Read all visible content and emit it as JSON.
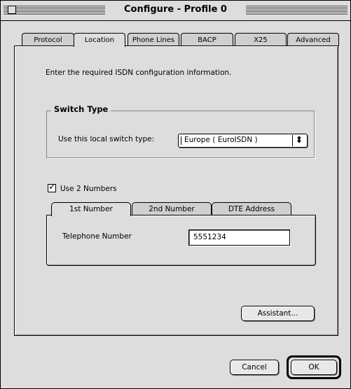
{
  "window": {
    "title": "Configure - Profile 0"
  },
  "tabs": [
    "Protocol",
    "Location",
    "Phone Lines",
    "BACP",
    "X25",
    "Advanced"
  ],
  "selected_tab": "Location",
  "instructions": "Enter the required ISDN configuration information.",
  "switch_type": {
    "group_title": "Switch Type",
    "label": "Use this local switch type:",
    "selected": "Europe ( EuroISDN )"
  },
  "use_two_numbers": {
    "label": "Use 2 Numbers",
    "checked": true,
    "check_glyph": "✓"
  },
  "number_tabs": [
    "1st Number",
    "2nd Number",
    "DTE Address"
  ],
  "selected_number_tab": "1st Number",
  "telephone": {
    "label": "Telephone Number",
    "value": "5551234"
  },
  "buttons": {
    "assistant": "Assistant...",
    "cancel": "Cancel",
    "ok": "OK"
  },
  "icons": {
    "popup_arrows": "⬍"
  }
}
